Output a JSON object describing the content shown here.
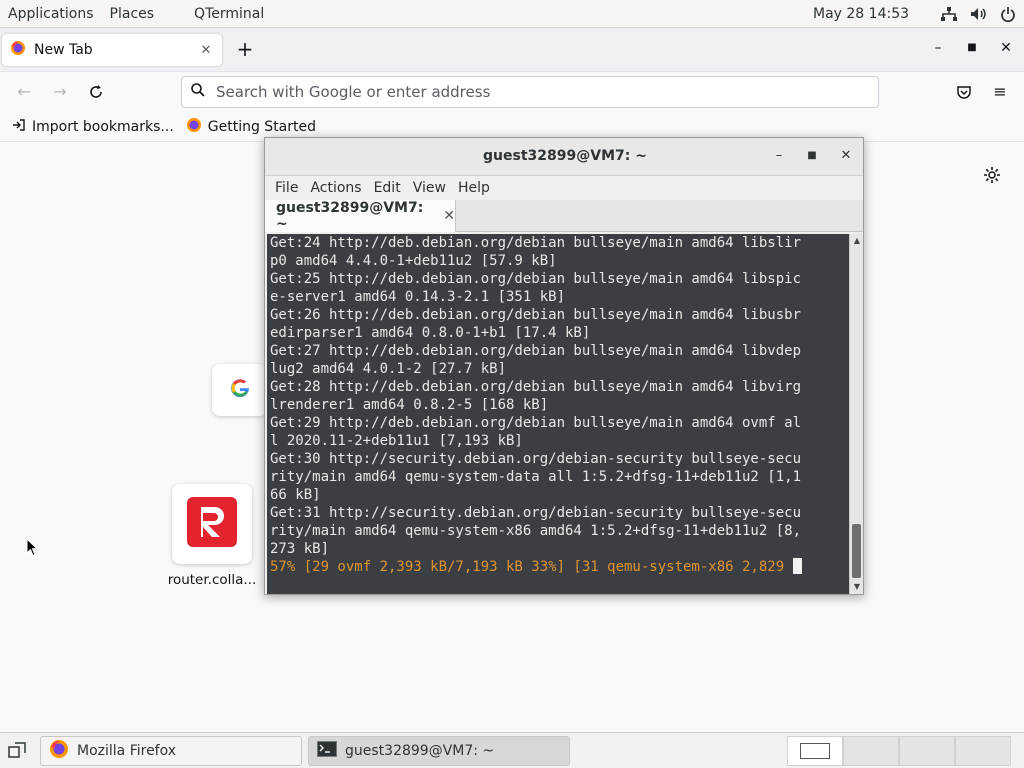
{
  "top_panel": {
    "menus": [
      "Applications",
      "Places",
      "QTerminal"
    ],
    "clock": "May 28  14:53",
    "tray_icons": [
      "network-icon",
      "volume-icon",
      "power-icon"
    ]
  },
  "firefox": {
    "tab_title": "New Tab",
    "url_placeholder": "Search with Google or enter address",
    "bookmarks": [
      "Import bookmarks...",
      "Getting Started"
    ],
    "shortcuts": [
      {
        "label": "router.colla..."
      }
    ],
    "colors": {
      "accent": "#e66000",
      "router_red": "#e3232e"
    }
  },
  "terminal": {
    "window_title": "guest32899@VM7: ~",
    "menus": [
      "File",
      "Actions",
      "Edit",
      "View",
      "Help"
    ],
    "tab_label": "guest32899@VM7: ~",
    "lines": [
      "Get:24 http://deb.debian.org/debian bullseye/main amd64 libslir",
      "p0 amd64 4.4.0-1+deb11u2 [57.9 kB]",
      "Get:25 http://deb.debian.org/debian bullseye/main amd64 libspic",
      "e-server1 amd64 0.14.3-2.1 [351 kB]",
      "Get:26 http://deb.debian.org/debian bullseye/main amd64 libusbr",
      "edirparser1 amd64 0.8.0-1+b1 [17.4 kB]",
      "Get:27 http://deb.debian.org/debian bullseye/main amd64 libvdep",
      "lug2 amd64 4.0.1-2 [27.7 kB]",
      "Get:28 http://deb.debian.org/debian bullseye/main amd64 libvirg",
      "lrenderer1 amd64 0.8.2-5 [168 kB]",
      "Get:29 http://deb.debian.org/debian bullseye/main amd64 ovmf al",
      "l 2020.11-2+deb11u1 [7,193 kB]",
      "Get:30 http://security.debian.org/debian-security bullseye-secu",
      "rity/main amd64 qemu-system-data all 1:5.2+dfsg-11+deb11u2 [1,1",
      "66 kB]",
      "Get:31 http://security.debian.org/debian-security bullseye-secu",
      "rity/main amd64 qemu-system-x86 amd64 1:5.2+dfsg-11+deb11u2 [8,",
      "273 kB]"
    ],
    "progress_line": "57% [29 ovmf 2,393 kB/7,193 kB 33%] [31 qemu-system-x86 2,829 ",
    "colors": {
      "background": "#3b3e43",
      "text": "#e8e8e8",
      "progress": "#e0942e"
    }
  },
  "taskbar": {
    "tasks": [
      {
        "label": "Mozilla Firefox",
        "active": false
      },
      {
        "label": "guest32899@VM7: ~",
        "active": true
      }
    ],
    "workspaces": 4
  }
}
